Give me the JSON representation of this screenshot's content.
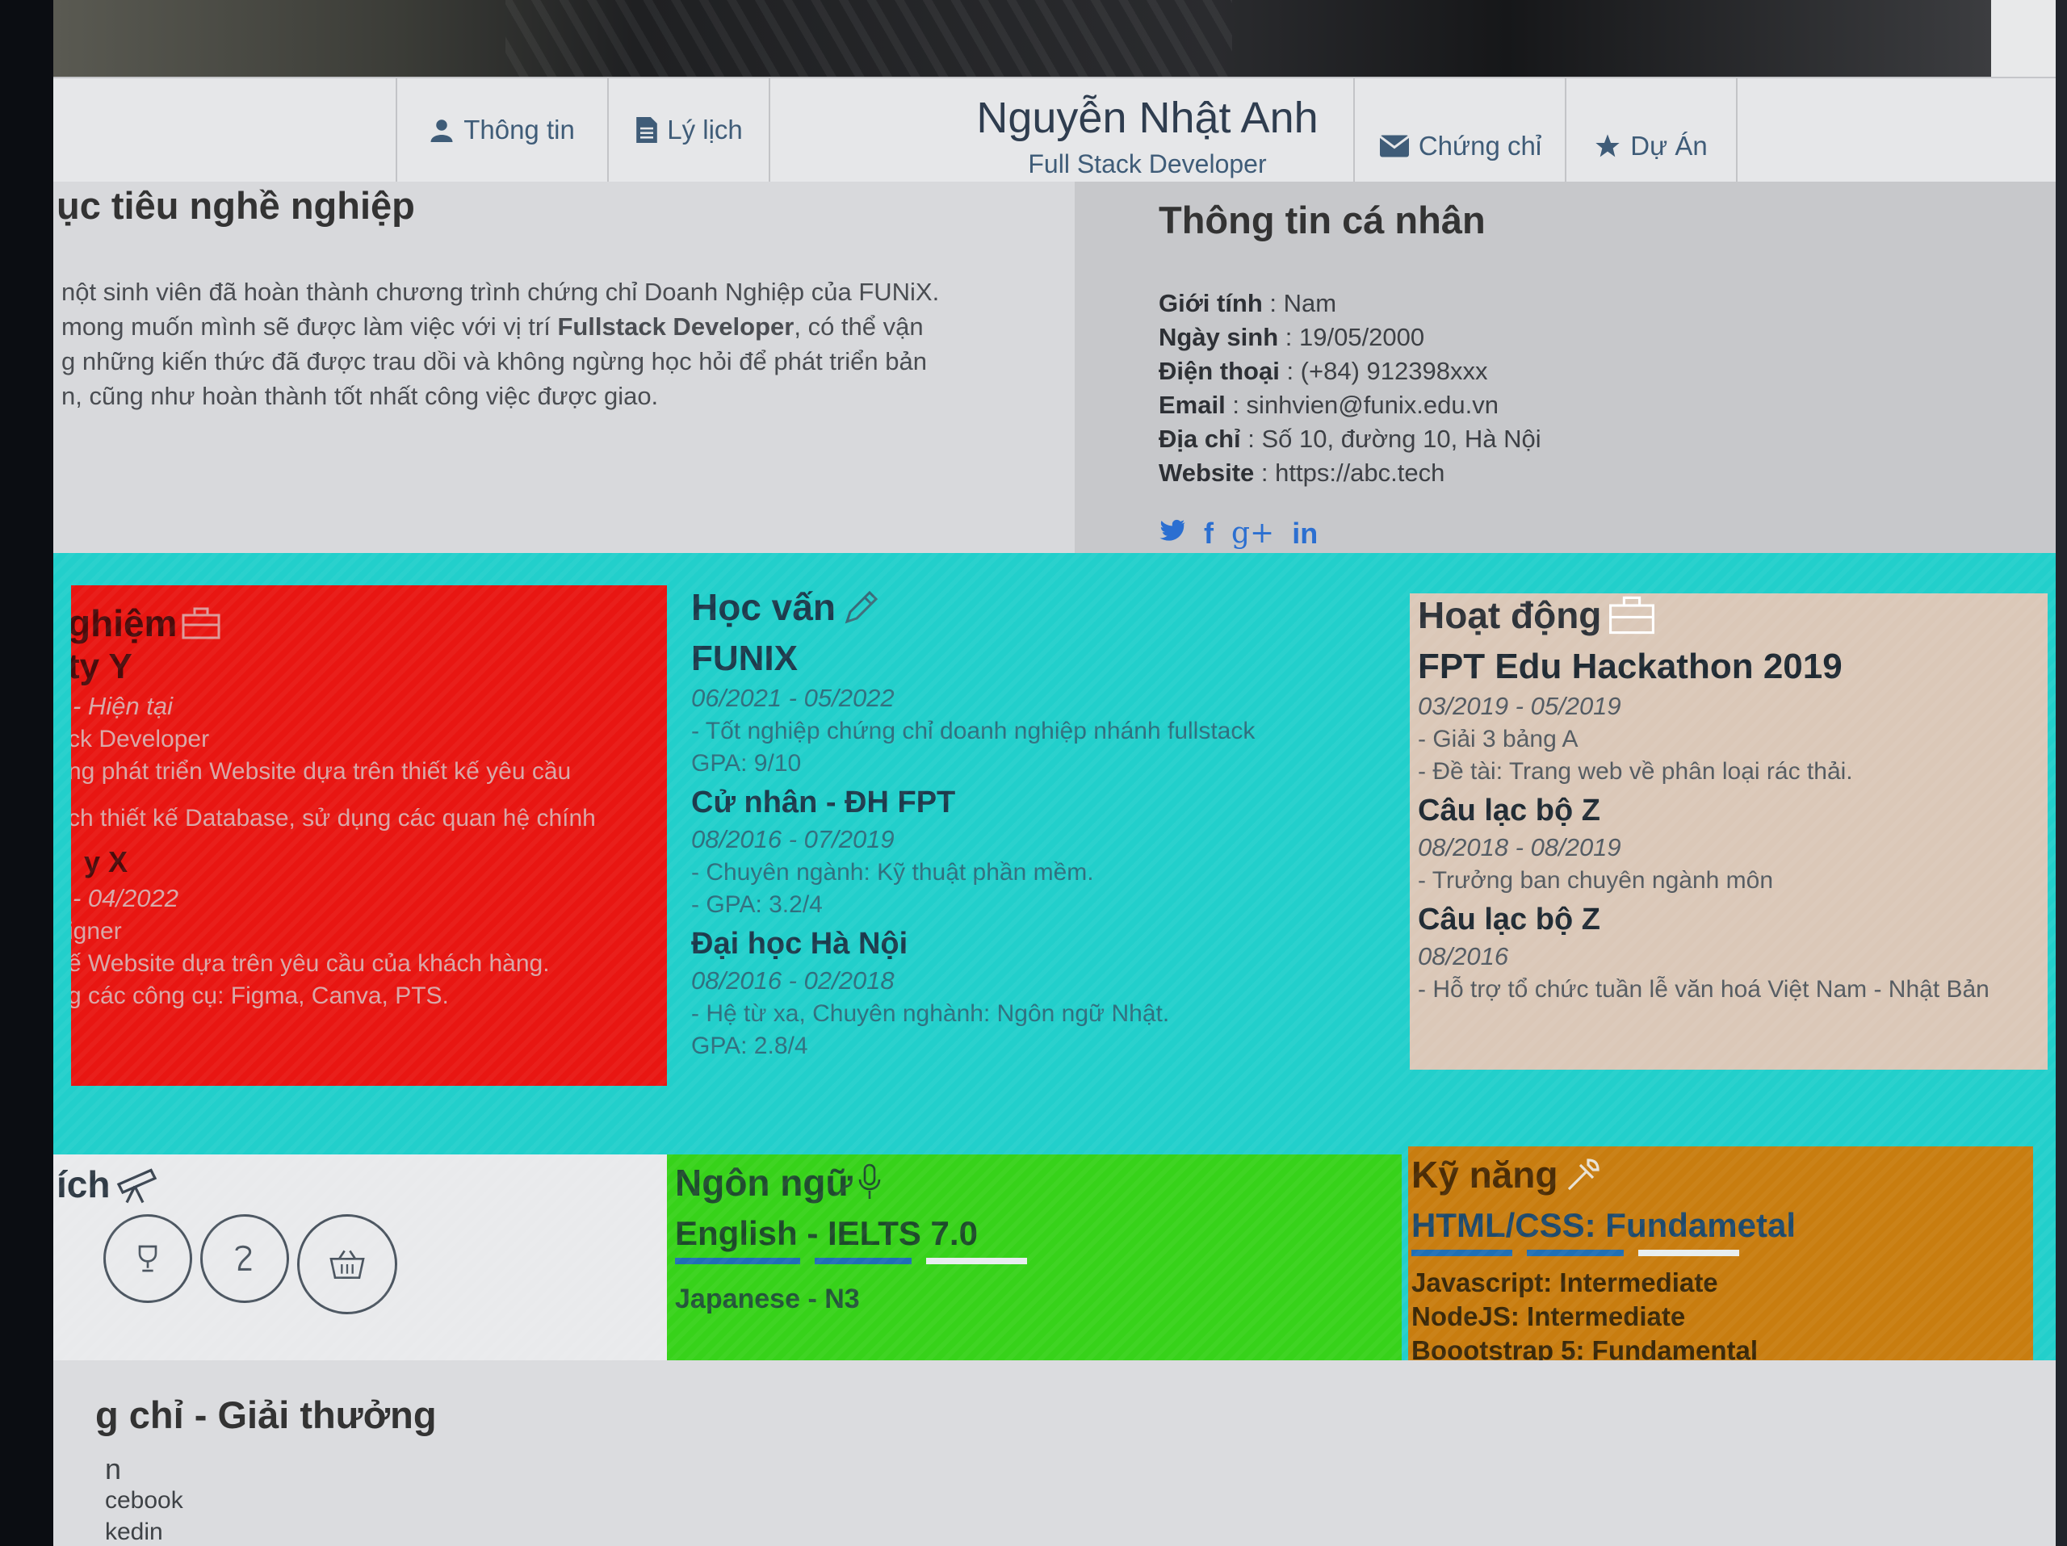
{
  "nav": {
    "items_left": [
      {
        "label": "Thông tin",
        "icon": "user-icon"
      },
      {
        "label": "Lý lịch",
        "icon": "file-icon"
      }
    ],
    "brand_name": "Nguyễn Nhật Anh",
    "brand_role": "Full Stack Developer",
    "items_right": [
      {
        "label": "Chứng chỉ",
        "icon": "envelope-icon"
      },
      {
        "label": "Dự Án",
        "icon": "star-icon"
      }
    ]
  },
  "objective": {
    "title": "ục tiêu nghề nghiệp",
    "line1": "nột sinh viên đã hoàn thành chương trình chứng chỉ Doanh Nghiệp của FUNiX.",
    "line2a": "mong muốn mình sẽ được làm việc với vị trí ",
    "line2b": "Fullstack Developer",
    "line2c": ", có thể vận",
    "line3": "g những kiến thức đã được trau dồi và không ngừng học hỏi để phát triển bản",
    "line4": "n, cũng như hoàn thành tốt nhất công việc được giao."
  },
  "personal": {
    "title": "Thông tin cá nhân",
    "rows": [
      {
        "label": "Giới tính",
        "value": " : Nam"
      },
      {
        "label": "Ngày sinh",
        "value": " : 19/05/2000"
      },
      {
        "label": "Điện thoại",
        "value": " : (+84) 912398xxx"
      },
      {
        "label": "Email",
        "value": " : sinhvien@funix.edu.vn"
      },
      {
        "label": "Địa chỉ",
        "value": " : Số 10, đường 10, Hà Nội"
      },
      {
        "label": "Website",
        "value": " : https://abc.tech"
      }
    ],
    "socials": [
      "twitter-icon",
      "facebook-icon",
      "google-plus-icon",
      "linkedin-icon"
    ],
    "social_text": {
      "facebook": "f",
      "gplus": "g+",
      "linkedin": "in"
    }
  },
  "experience": {
    "title": "ghiệm",
    "company1": "ty Y",
    "date1": "- Hiện tại",
    "role1": "ck Developer",
    "desc1a": "ng phát triển Website dựa trên thiết kế yêu cầu",
    "desc1b": "ch thiết kế Database, sử dụng các quan hệ chính",
    "company2": "y X",
    "date2": "- 04/2022",
    "role2": "igner",
    "desc2a": "ế Website dựa trên yêu cầu của khách hàng.",
    "desc2b": "g các công cụ: Figma, Canva, PTS."
  },
  "education": {
    "title": "Học vấn",
    "school1": "FUNIX",
    "date1": "06/2021 - 05/2022",
    "line1a": "- Tốt nghiệp chứng chỉ doanh nghiệp nhánh fullstack",
    "line1b": "GPA: 9/10",
    "school2": "Cử nhân - ĐH FPT",
    "date2": "08/2016 - 07/2019",
    "line2a": "- Chuyên ngành: Kỹ thuật phần mềm.",
    "line2b": "- GPA: 3.2/4",
    "school3": "Đại học Hà Nội",
    "date3": "08/2016 - 02/2018",
    "line3a": "- Hệ từ xa, Chuyên nghành: Ngôn ngữ Nhật.",
    "line3b": "GPA: 2.8/4"
  },
  "activities": {
    "title": "Hoạt động",
    "item1": "FPT Edu Hackathon 2019",
    "date1": "03/2019 - 05/2019",
    "line1a": "- Giải 3 bảng A",
    "line1b": "- Đề tài: Trang web về phân loại rác thải.",
    "item2": "Câu lạc bộ Z",
    "date2": "08/2018 - 08/2019",
    "line2a": "- Trưởng ban chuyên ngành môn",
    "item3": "Câu lạc bộ Z",
    "date3": "08/2016",
    "line3a": "- Hỗ trợ tổ chức tuần lễ văn hoá Việt Nam - Nhật Bản"
  },
  "hobbies": {
    "title": "ích"
  },
  "languages": {
    "title": "Ngôn ngữ",
    "lang1": "English - IELTS 7.0",
    "lang1_level": 0.75,
    "lang2": "Japanese - N3"
  },
  "skills": {
    "title": "Kỹ năng",
    "skill1": "HTML/CSS: Fundametal",
    "skill1_level": 0.75,
    "skill2": "Javascript: Intermediate",
    "skill3": "NodeJS: Intermediate",
    "skill4": "Boootstrap 5: Fundamental"
  },
  "awards": {
    "title": "g chỉ - Giải thưởng",
    "item1": "n",
    "item2": "cebook",
    "item3": "kedin"
  },
  "colors": {
    "band": "#22cfcb",
    "experience": "#e81612",
    "activities": "#dbc8b8",
    "languages": "#37d21a",
    "skills": "#c87d10",
    "bar_fill": "#1f6fb5",
    "bar_empty": "#e8eef0"
  }
}
